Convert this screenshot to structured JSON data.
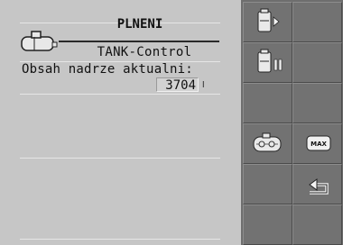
{
  "header": {
    "title": "PLNENI"
  },
  "main": {
    "subtitle": "TANK-Control",
    "label": "Obsah nadrze aktualni:",
    "value": "3704",
    "unit": "l"
  },
  "softkeys": [
    {
      "icon": "fill-start-icon"
    },
    {
      "icon": ""
    },
    {
      "icon": "fill-pause-icon"
    },
    {
      "icon": ""
    },
    {
      "icon": ""
    },
    {
      "icon": ""
    },
    {
      "icon": "tank-settings-icon"
    },
    {
      "icon": "max-icon",
      "label": "MAX"
    },
    {
      "icon": ""
    },
    {
      "icon": "back-icon"
    },
    {
      "icon": ""
    },
    {
      "icon": ""
    }
  ]
}
